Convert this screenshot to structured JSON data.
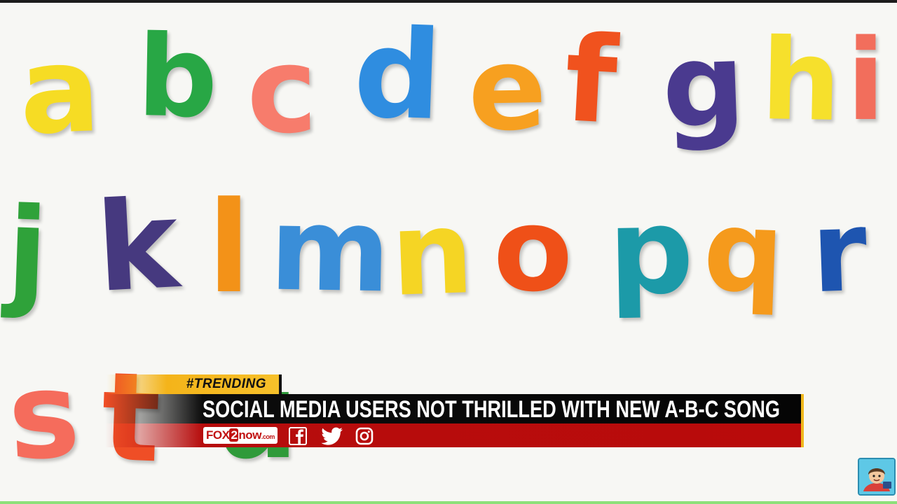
{
  "letters": [
    {
      "char": "a",
      "color": "#f6dc24"
    },
    {
      "char": "b",
      "color": "#28a745"
    },
    {
      "char": "c",
      "color": "#f77c6c"
    },
    {
      "char": "d",
      "color": "#2f8de0"
    },
    {
      "char": "e",
      "color": "#f7a020"
    },
    {
      "char": "f",
      "color": "#f0521e"
    },
    {
      "char": "g",
      "color": "#4a3a8f"
    },
    {
      "char": "h",
      "color": "#f6e02c"
    },
    {
      "char": "i",
      "color": "#f26e5c"
    },
    {
      "char": "j",
      "color": "#2fa23a"
    },
    {
      "char": "k",
      "color": "#46397f"
    },
    {
      "char": "l",
      "color": "#f39218"
    },
    {
      "char": "m",
      "color": "#3a8ed8"
    },
    {
      "char": "n",
      "color": "#f5d524"
    },
    {
      "char": "o",
      "color": "#ef5018"
    },
    {
      "char": "p",
      "color": "#1c9aa8"
    },
    {
      "char": "q",
      "color": "#f59a1c"
    },
    {
      "char": "r",
      "color": "#1e55b0"
    },
    {
      "char": "s",
      "color": "#f56c5c"
    },
    {
      "char": "t",
      "color": "#ef4e26"
    },
    {
      "char": "u",
      "color": "#2f9a3a"
    }
  ],
  "lower_third": {
    "tag": "#TRENDING",
    "headline": "SOCIAL MEDIA USERS NOT THRILLED WITH NEW A-B-C SONG",
    "brand": {
      "prefix": "FOX",
      "number": "2",
      "suffix": "now",
      "tld": ".com"
    },
    "social_icons": [
      "facebook-icon",
      "twitter-icon",
      "instagram-icon"
    ]
  },
  "colors": {
    "tag_yellow": "#f4b41a",
    "headline_black": "#050505",
    "social_red": "#b90b0b"
  },
  "corner_badge_icon": "cartoon-avatar-icon"
}
